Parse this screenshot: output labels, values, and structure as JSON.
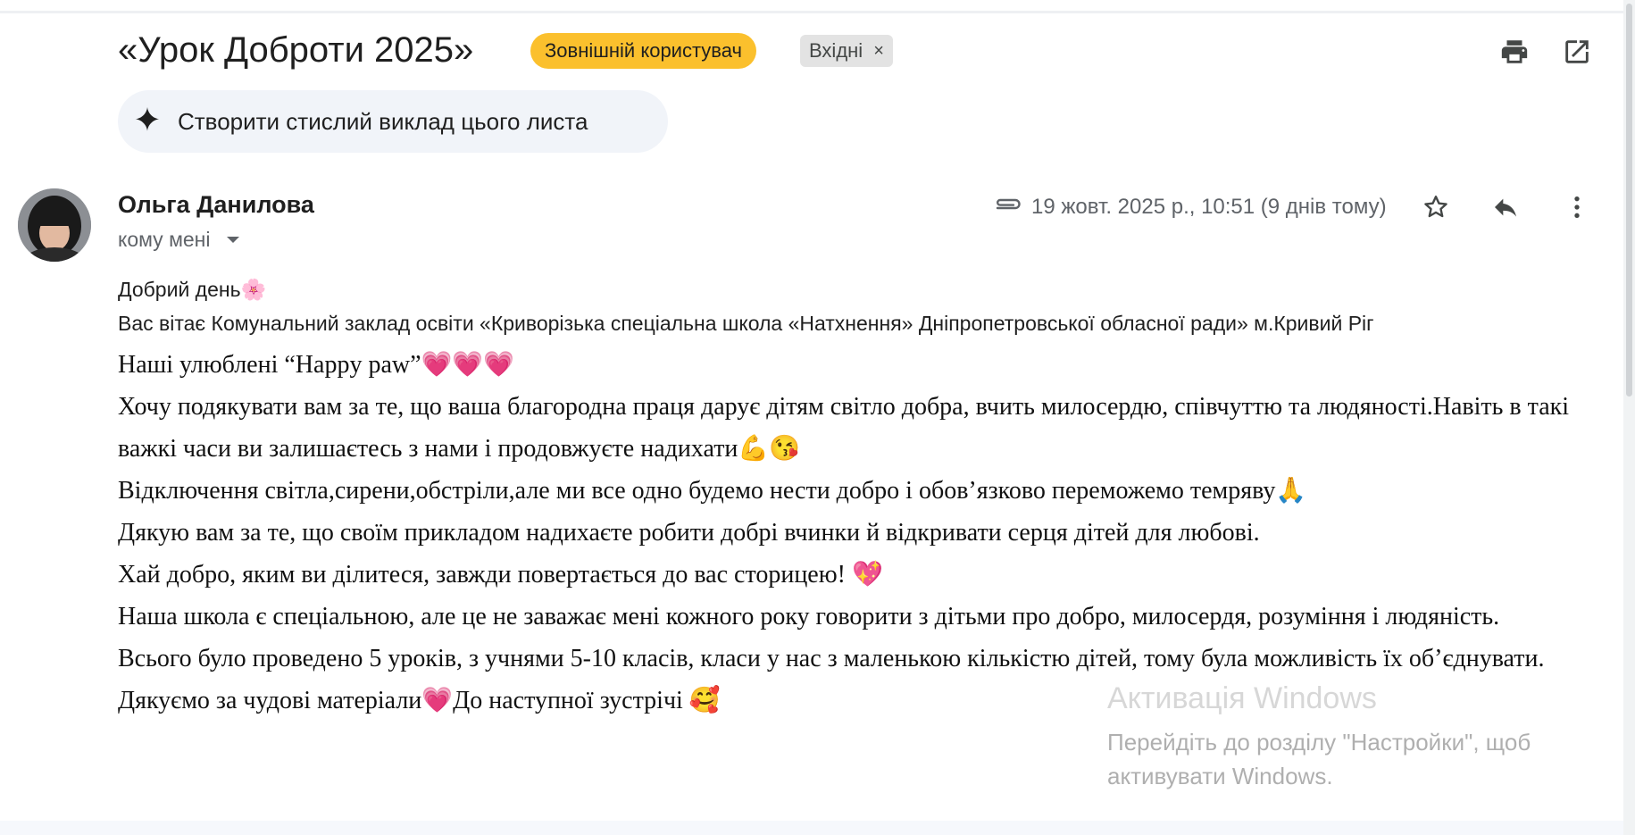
{
  "subject": "«Урок Доброти 2025»",
  "labels": {
    "external_user": "Зовнішній користувач",
    "inbox": "Вхідні",
    "inbox_remove": "×"
  },
  "summary_button": "Створити стислий виклад цього листа",
  "sender": {
    "name": "Ольга Данилова",
    "recipient": "кому мені"
  },
  "date": "19 жовт. 2025 р., 10:51 (9 днів тому)",
  "icons": {
    "print": "print-icon",
    "open_new_window": "open-in-new-window-icon",
    "attachment": "paperclip-icon",
    "star": "star-icon",
    "reply": "reply-icon",
    "more": "more-vert-icon",
    "summary": "sparkle-icon"
  },
  "body": {
    "greeting": "Добрий день🌸",
    "intro": "Вас вітає Комунальний заклад освіти «Криворізька спеціальна школа «Натхнення» Дніпропетровської обласної ради» м.Кривий Ріг",
    "lines": [
      "Наші улюблені “Happy paw”💗💗💗",
      "Хочу подякувати  вам за те, що ваша благородна праця дарує дітям світло добра, вчить милосердю, співчуттю та людяності.Навіть в такі важкі часи ви залишаєтесь з нами  і продовжуєте надихати💪😘",
      "Відключення світла,сирени,обстріли,але ми все одно будемо нести добро і обов’язково переможемо темряву🙏",
      "Дякую вам за те, що своїм прикладом надихаєте робити добрі вчинки й відкривати серця дітей для любові.",
      "Хай добро, яким ви ділитеся, завжди повертається до вас сторицею! 💖",
      "Наша школа є спеціальною, але це не заважає мені кожного року говорити з дітьми про добро, милосердя, розуміння і людяність.",
      "Всього було проведено 5 уроків, з учнями 5-10 класів, класи у нас з маленькою кількістю дітей, тому була можливість їх об’єднувати.",
      "Дякуємо за чудові матеріали💗До наступної зустрічі 🥰"
    ]
  },
  "watermark": {
    "title": "Активація Windows",
    "line1": "Перейдіть до розділу \"Настройки\", щоб",
    "line2": "активувати Windows."
  },
  "colors": {
    "external_badge": "#fbc02d",
    "inbox_badge": "#e3e3e3",
    "summary_bg": "#f1f4f9",
    "meta_text": "#5f6368"
  }
}
